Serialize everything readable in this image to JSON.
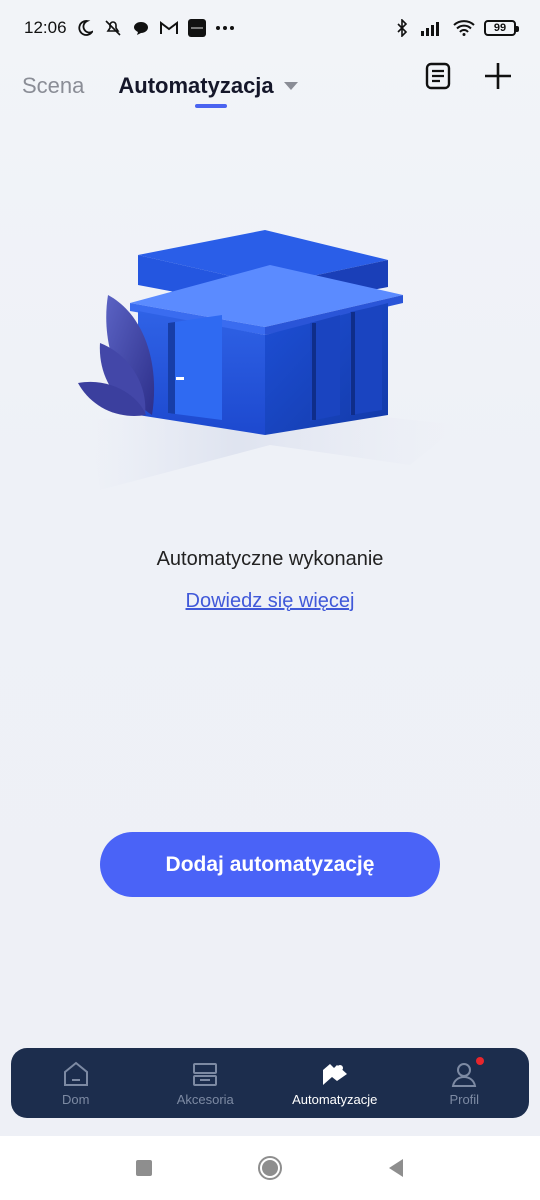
{
  "status_bar": {
    "time": "12:06",
    "battery": "99",
    "left_icons": [
      "moon-icon",
      "mute-icon",
      "chat-icon",
      "gmail-icon",
      "app-icon",
      "more-icon"
    ],
    "right_icons": [
      "bluetooth-icon",
      "signal-icon",
      "wifi-icon",
      "battery-icon"
    ]
  },
  "header": {
    "tab_scene": "Scena",
    "tab_automation": "Automatyzacja",
    "actions": [
      "log-icon",
      "add-icon"
    ]
  },
  "empty_state": {
    "title": "Automatyczne wykonanie",
    "link": "Dowiedz się więcej"
  },
  "primary_button": {
    "label": "Dodaj automatyzację",
    "color": "#4a63f7"
  },
  "bottom_nav": {
    "items": [
      {
        "label": "Dom",
        "icon": "home-icon",
        "active": false
      },
      {
        "label": "Akcesoria",
        "icon": "devices-icon",
        "active": false
      },
      {
        "label": "Automatyzacje",
        "icon": "automation-icon",
        "active": true
      },
      {
        "label": "Profil",
        "icon": "profile-icon",
        "active": false,
        "badge": true
      }
    ],
    "background": "#1c2d4d"
  },
  "system_nav": [
    "recents-button",
    "home-button",
    "back-button"
  ],
  "colors": {
    "accent": "#4a63f0",
    "link": "#4059d9",
    "badge": "#e8262c"
  }
}
